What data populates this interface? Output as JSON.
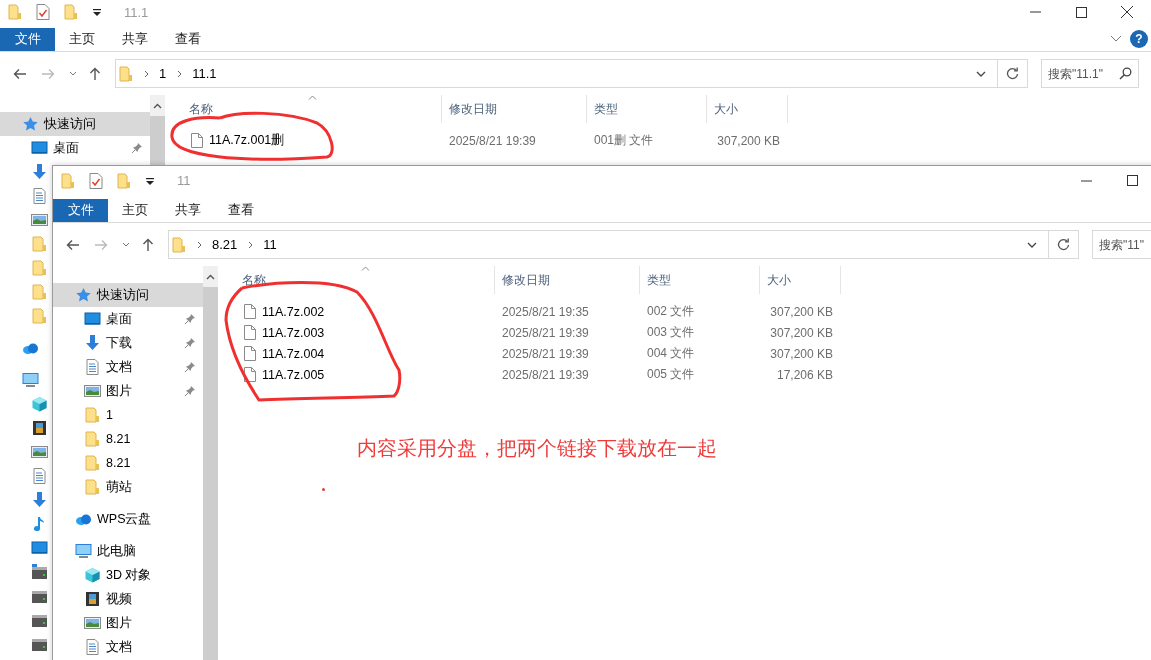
{
  "windows": [
    {
      "title": "11.1",
      "ribbon_tabs": [
        {
          "label": "文件",
          "selected": true
        },
        {
          "label": "主页",
          "selected": false
        },
        {
          "label": "共享",
          "selected": false
        },
        {
          "label": "查看",
          "selected": false
        }
      ],
      "controls": [
        {
          "kind": "minimize"
        },
        {
          "kind": "maximize"
        },
        {
          "kind": "close"
        }
      ],
      "help": "?",
      "path": [
        "1",
        "11.1"
      ],
      "search": {
        "placeholder": "搜索\"11.1\""
      },
      "sidebar": [
        {
          "kind": "quick",
          "label": "快速访问",
          "selected": true,
          "children": [
            {
              "kind": "desktop",
              "label": "桌面",
              "pinned": true
            },
            {
              "kind": "download"
            },
            {
              "kind": "doc"
            },
            {
              "kind": "picture"
            },
            {
              "kind": "folder"
            },
            {
              "kind": "folder"
            },
            {
              "kind": "folder"
            },
            {
              "kind": "folder"
            }
          ]
        },
        {
          "kind": "cloud"
        },
        {
          "kind": "pc",
          "children": [
            {
              "kind": "cube"
            },
            {
              "kind": "video"
            },
            {
              "kind": "picture"
            },
            {
              "kind": "doc"
            },
            {
              "kind": "download"
            },
            {
              "kind": "music"
            },
            {
              "kind": "desktop"
            },
            {
              "kind": "netdrive"
            },
            {
              "kind": "drive"
            },
            {
              "kind": "drive"
            },
            {
              "kind": "drive"
            }
          ]
        }
      ],
      "columns": [
        "名称",
        "修改日期",
        "类型",
        "大小"
      ],
      "rows": [
        {
          "name": "11A.7z.001删",
          "date": "2025/8/21 19:39",
          "type": "001删 文件",
          "size": "307,200 KB"
        }
      ]
    },
    {
      "title": "11",
      "ribbon_tabs": [
        {
          "label": "文件",
          "selected": true
        },
        {
          "label": "主页",
          "selected": false
        },
        {
          "label": "共享",
          "selected": false
        },
        {
          "label": "查看",
          "selected": false
        }
      ],
      "controls": [
        {
          "kind": "minimize"
        },
        {
          "kind": "maximize"
        }
      ],
      "path": [
        "8.21",
        "11"
      ],
      "search": {
        "placeholder": "搜索\"11\""
      },
      "sidebar": [
        {
          "kind": "quick",
          "label": "快速访问",
          "selected": true,
          "children": [
            {
              "kind": "desktop",
              "label": "桌面",
              "pinned": true
            },
            {
              "kind": "download",
              "label": "下载",
              "pinned": true
            },
            {
              "kind": "doc",
              "label": "文档",
              "pinned": true
            },
            {
              "kind": "picture",
              "label": "图片",
              "pinned": true
            },
            {
              "kind": "folder",
              "label": "1",
              "pinned": false
            },
            {
              "kind": "folder",
              "label": "8.21",
              "pinned": false
            },
            {
              "kind": "folder",
              "label": "8.21",
              "pinned": false
            },
            {
              "kind": "folder",
              "label": "萌站",
              "pinned": false
            }
          ]
        },
        {
          "kind": "cloud",
          "label": "WPS云盘"
        },
        {
          "kind": "pc",
          "label": "此电脑",
          "children": [
            {
              "kind": "cube",
              "label": "3D 对象"
            },
            {
              "kind": "video",
              "label": "视频"
            },
            {
              "kind": "picture",
              "label": "图片"
            },
            {
              "kind": "doc",
              "label": "文档"
            }
          ]
        }
      ],
      "columns": [
        "名称",
        "修改日期",
        "类型",
        "大小"
      ],
      "rows": [
        {
          "name": "11A.7z.002",
          "date": "2025/8/21 19:35",
          "type": "002 文件",
          "size": "307,200 KB"
        },
        {
          "name": "11A.7z.003",
          "date": "2025/8/21 19:39",
          "type": "003 文件",
          "size": "307,200 KB"
        },
        {
          "name": "11A.7z.004",
          "date": "2025/8/21 19:39",
          "type": "004 文件",
          "size": "307,200 KB"
        },
        {
          "name": "11A.7z.005",
          "date": "2025/8/21 19:39",
          "type": "005 文件",
          "size": "17,206 KB"
        }
      ],
      "note": "内容采用分盘，把两个链接下载放在一起"
    }
  ]
}
